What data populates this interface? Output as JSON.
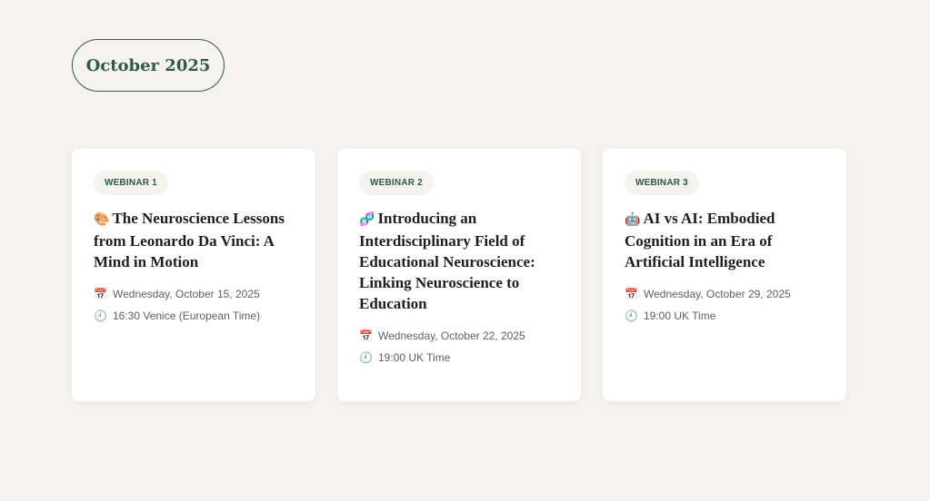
{
  "header": {
    "month_label": "October 2025"
  },
  "cards": [
    {
      "badge": "WEBINAR 1",
      "emoji": "🎨",
      "title": "The Neuroscience Lessons from Leonardo Da Vinci: A Mind in Motion",
      "date": "Wednesday, October 15, 2025",
      "time": "16:30 Venice (European Time)"
    },
    {
      "badge": "WEBINAR 2",
      "emoji": "🧬",
      "title": "Introducing an Interdisciplinary Field of Educational Neuroscience: Linking Neuroscience to Education",
      "date": "Wednesday, October 22, 2025",
      "time": "19:00 UK Time"
    },
    {
      "badge": "WEBINAR 3",
      "emoji": "🤖",
      "title": "AI vs AI: Embodied Cognition in an Era of Artificial Intelligence",
      "date": "Wednesday, October 29, 2025",
      "time": "19:00 UK Time"
    }
  ],
  "icons": {
    "calendar": "📅",
    "clock": "🕘"
  },
  "colors": {
    "accent": "#2f5a45",
    "background": "#f6f3ef",
    "card": "#ffffff"
  }
}
